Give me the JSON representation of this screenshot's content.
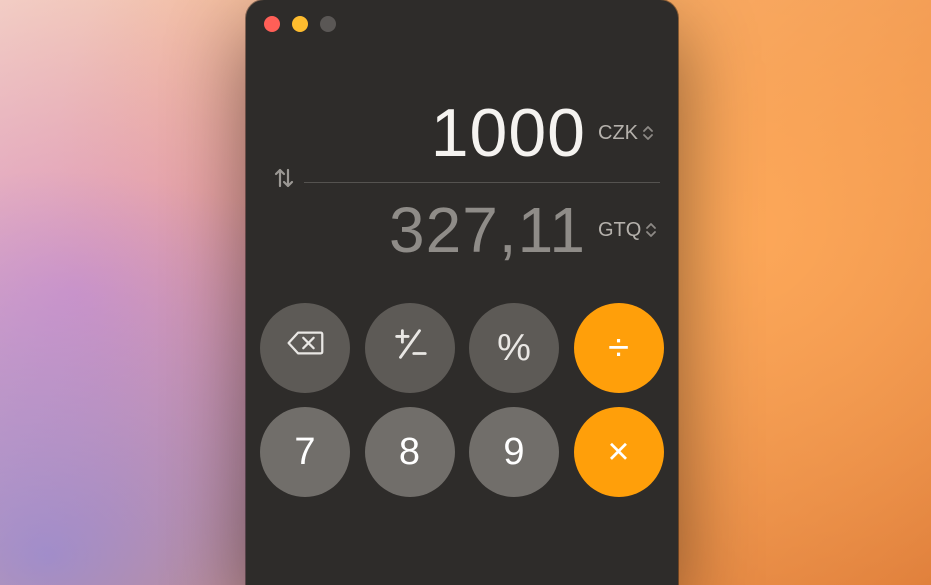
{
  "window": {
    "traffic": {
      "close": "#ff5f57",
      "minimize": "#febc2e",
      "maximize_disabled": "#5a5755"
    }
  },
  "conversion": {
    "from": {
      "amount": "1000",
      "currency": "CZK"
    },
    "to": {
      "amount": "327,11",
      "currency": "GTQ"
    }
  },
  "keys": {
    "backspace": "⌫",
    "negate": "⁺⁄₋",
    "percent": "%",
    "divide": "÷",
    "seven": "7",
    "eight": "8",
    "nine": "9",
    "multiply": "×"
  }
}
